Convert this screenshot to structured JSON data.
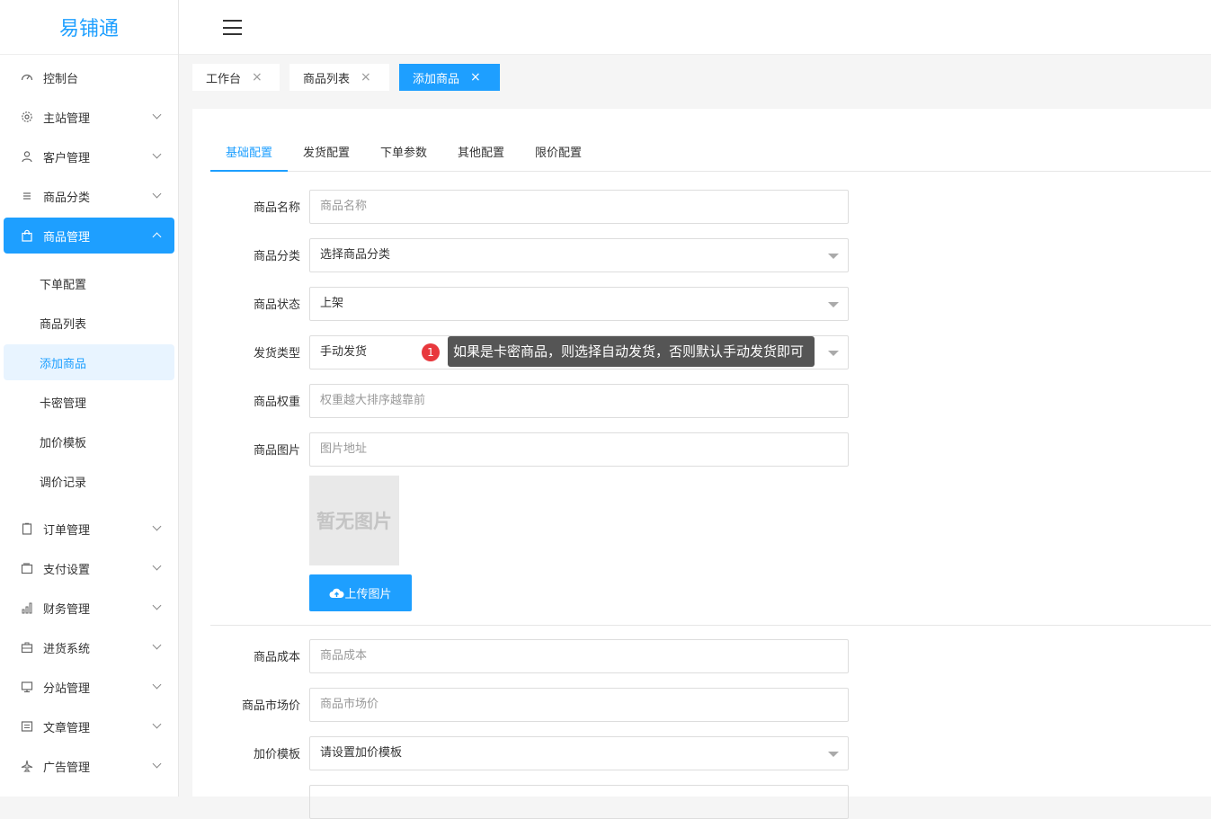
{
  "app": {
    "logo": "易铺通"
  },
  "sidebar": {
    "items": [
      {
        "label": "控制台",
        "icon": "dashboard-icon"
      },
      {
        "label": "主站管理",
        "icon": "gear-icon"
      },
      {
        "label": "客户管理",
        "icon": "user-icon"
      },
      {
        "label": "商品分类",
        "icon": "list-icon"
      },
      {
        "label": "商品管理",
        "icon": "bag-icon"
      },
      {
        "label": "订单管理",
        "icon": "clipboard-icon"
      },
      {
        "label": "支付设置",
        "icon": "wallet-icon"
      },
      {
        "label": "财务管理",
        "icon": "bar-chart-icon"
      },
      {
        "label": "进货系统",
        "icon": "briefcase-icon"
      },
      {
        "label": "分站管理",
        "icon": "monitor-icon"
      },
      {
        "label": "文章管理",
        "icon": "article-icon"
      },
      {
        "label": "广告管理",
        "icon": "plane-icon"
      }
    ],
    "sub_items": [
      "下单配置",
      "商品列表",
      "添加商品",
      "卡密管理",
      "加价模板",
      "调价记录"
    ]
  },
  "tabs": [
    {
      "label": "工作台",
      "close": "×"
    },
    {
      "label": "商品列表",
      "close": "×"
    },
    {
      "label": "添加商品",
      "close": "×"
    }
  ],
  "form": {
    "subtabs": [
      "基础配置",
      "发货配置",
      "下单参数",
      "其他配置",
      "限价配置"
    ],
    "fields": {
      "name": {
        "label": "商品名称",
        "placeholder": "商品名称"
      },
      "category": {
        "label": "商品分类",
        "value": "选择商品分类"
      },
      "status": {
        "label": "商品状态",
        "value": "上架"
      },
      "ship_type": {
        "label": "发货类型",
        "value": "手动发货"
      },
      "weight": {
        "label": "商品权重",
        "placeholder": "权重越大排序越靠前"
      },
      "image": {
        "label": "商品图片",
        "placeholder": "图片地址"
      },
      "cost": {
        "label": "商品成本",
        "placeholder": "商品成本"
      },
      "market_price": {
        "label": "商品市场价",
        "placeholder": "商品市场价"
      },
      "markup_template": {
        "label": "加价模板",
        "value": "请设置加价模板"
      }
    },
    "no_image_text": "暂无图片",
    "upload_label": "上传图片",
    "tooltip": {
      "badge": "1",
      "text": "如果是卡密商品，则选择自动发货，否则默认手动发货即可"
    }
  }
}
